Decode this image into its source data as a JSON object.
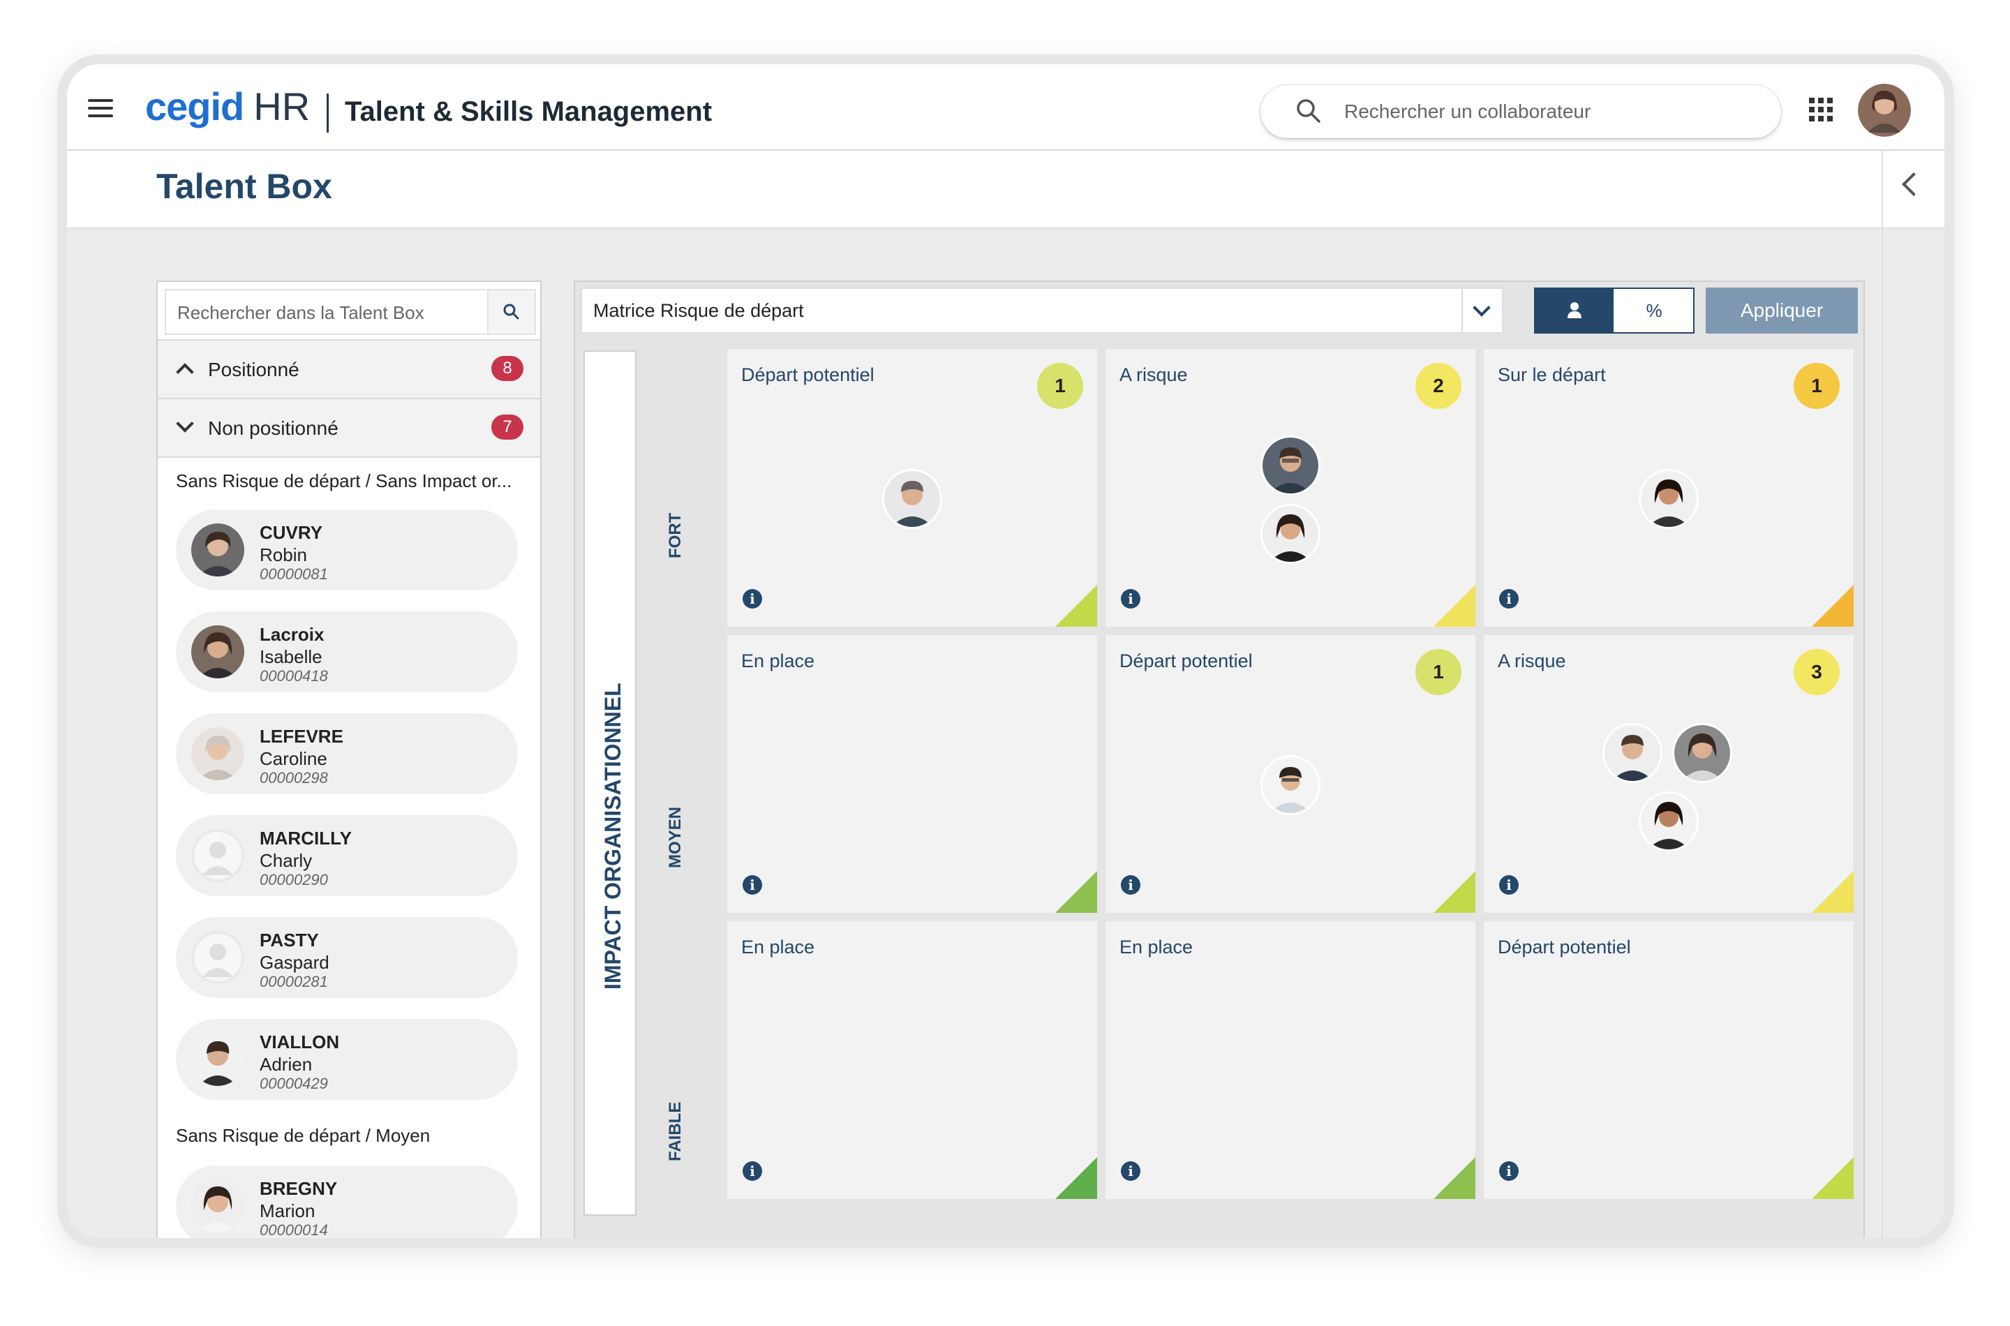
{
  "header": {
    "logo_brand": "cegid",
    "logo_product": "HR",
    "app_title": "Talent & Skills Management",
    "search_placeholder": "Rechercher un collaborateur",
    "apps_icon": "grid-icon",
    "user_avatar": "user-avatar"
  },
  "page": {
    "title": "Talent Box"
  },
  "left_panel": {
    "search_placeholder": "Rechercher dans la Talent Box",
    "groups": [
      {
        "label": "Positionné",
        "count": "8",
        "expanded": false
      },
      {
        "label": "Non positionné",
        "count": "7",
        "expanded": true
      }
    ],
    "sections": [
      {
        "label": "Sans Risque de départ / Sans Impact or...",
        "people": [
          {
            "last": "CUVRY",
            "first": "Robin",
            "id": "00000081"
          },
          {
            "last": "Lacroix",
            "first": "Isabelle",
            "id": "00000418"
          },
          {
            "last": "LEFEVRE",
            "first": "Caroline",
            "id": "00000298"
          },
          {
            "last": "MARCILLY",
            "first": "Charly",
            "id": "00000290"
          },
          {
            "last": "PASTY",
            "first": "Gaspard",
            "id": "00000281"
          },
          {
            "last": "VIALLON",
            "first": "Adrien",
            "id": "00000429"
          }
        ]
      },
      {
        "label": "Sans Risque de départ / Moyen",
        "people": [
          {
            "last": "BREGNY",
            "first": "Marion",
            "id": "00000014"
          }
        ]
      }
    ]
  },
  "matrix": {
    "selected": "Matrice Risque de départ",
    "toggle_percent": "%",
    "apply_label": "Appliquer",
    "y_axis_title": "IMPACT ORGANISATIONNEL",
    "rows": [
      "FORT",
      "MOYEN",
      "FAIBLE"
    ],
    "cells": [
      [
        {
          "title": "Départ potentiel",
          "count": "1",
          "badge_color": "#d6e26a",
          "corner": "#c4d94a"
        },
        {
          "title": "A risque",
          "count": "2",
          "badge_color": "#f3e660",
          "corner": "#f0e25a"
        },
        {
          "title": "Sur le départ",
          "count": "1",
          "badge_color": "#f5c842",
          "corner": "#f2b634"
        }
      ],
      [
        {
          "title": "En place",
          "count": "",
          "badge_color": "",
          "corner": "#8fbf4e"
        },
        {
          "title": "Départ potentiel",
          "count": "1",
          "badge_color": "#d6e26a",
          "corner": "#c4d94a"
        },
        {
          "title": "A risque",
          "count": "3",
          "badge_color": "#f3e660",
          "corner": "#f0e25a"
        }
      ],
      [
        {
          "title": "En place",
          "count": "",
          "badge_color": "",
          "corner": "#5fae4a"
        },
        {
          "title": "En place",
          "count": "",
          "badge_color": "",
          "corner": "#8fbf4e"
        },
        {
          "title": "Départ potentiel",
          "count": "",
          "badge_color": "",
          "corner": "#c4d94a"
        }
      ]
    ]
  }
}
